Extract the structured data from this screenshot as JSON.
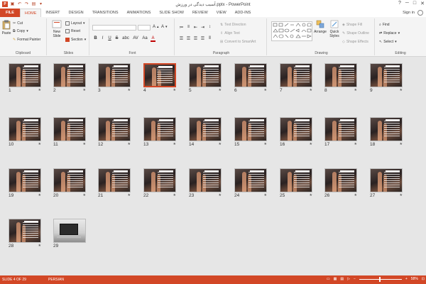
{
  "title": "آسیب دیدگی در ورزش.pptx - PowerPoint",
  "window_controls": [
    "?",
    "─",
    "□",
    "✕"
  ],
  "tabs": [
    "FILE",
    "HOME",
    "INSERT",
    "DESIGN",
    "TRANSITIONS",
    "ANIMATIONS",
    "SLIDE SHOW",
    "REVIEW",
    "VIEW",
    "ADD-INS"
  ],
  "active_tab": "HOME",
  "sign_in": "Sign in",
  "clipboard": {
    "paste": "Paste",
    "cut": "Cut",
    "copy": "Copy",
    "format_painter": "Format Painter",
    "label": "Clipboard"
  },
  "slides_group": {
    "new_slide": "New Slide",
    "layout": "Layout",
    "reset": "Reset",
    "section": "Section",
    "label": "Slides"
  },
  "font_group": {
    "label": "Font",
    "bold": "B",
    "italic": "I",
    "underline": "U",
    "strike": "S",
    "shadow": "abc",
    "spacing": "AV",
    "case": "Aa",
    "color": "A"
  },
  "paragraph_group": {
    "label": "Paragraph",
    "text_direction": "Text Direction",
    "align_text": "Align Text",
    "convert_smartart": "Convert to SmartArt"
  },
  "drawing_group": {
    "label": "Drawing",
    "arrange": "Arrange",
    "quick_styles": "Quick Styles",
    "shape_fill": "Shape Fill",
    "shape_outline": "Shape Outline",
    "shape_effects": "Shape Effects"
  },
  "editing_group": {
    "label": "Editing",
    "find": "Find",
    "replace": "Replace",
    "select": "Select"
  },
  "slides": [
    "1",
    "2",
    "3",
    "4",
    "5",
    "6",
    "7",
    "8",
    "9",
    "10",
    "11",
    "12",
    "13",
    "14",
    "15",
    "16",
    "17",
    "18",
    "19",
    "20",
    "21",
    "22",
    "23",
    "24",
    "25",
    "26",
    "27",
    "28",
    "29"
  ],
  "selected_slide": 4,
  "status": {
    "slide_info": "SLIDE 4 OF 29",
    "language": "PERSIAN",
    "zoom": "58%"
  },
  "colors": {
    "accent": "#d24726",
    "ribbon": "#f4f4f4",
    "workspace": "#e6e6e6"
  }
}
